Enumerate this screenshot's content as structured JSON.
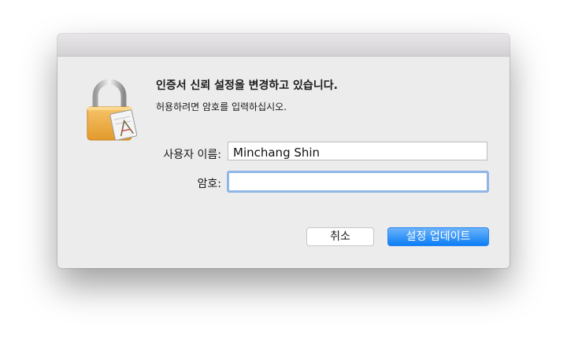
{
  "dialog": {
    "heading": "인증서 신뢰 설정을 변경하고 있습니다.",
    "subtext": "허용하려면 암호를 입력하십시오.",
    "icon": "lock-icon",
    "username_label": "사용자 이름:",
    "username_value": "Minchang Shin",
    "password_label": "암호:",
    "password_value": "",
    "cancel_label": "취소",
    "update_label": "설정 업데이트",
    "accent_color": "#0b7ef5",
    "focus_ring_color": "#8fb6e6"
  }
}
